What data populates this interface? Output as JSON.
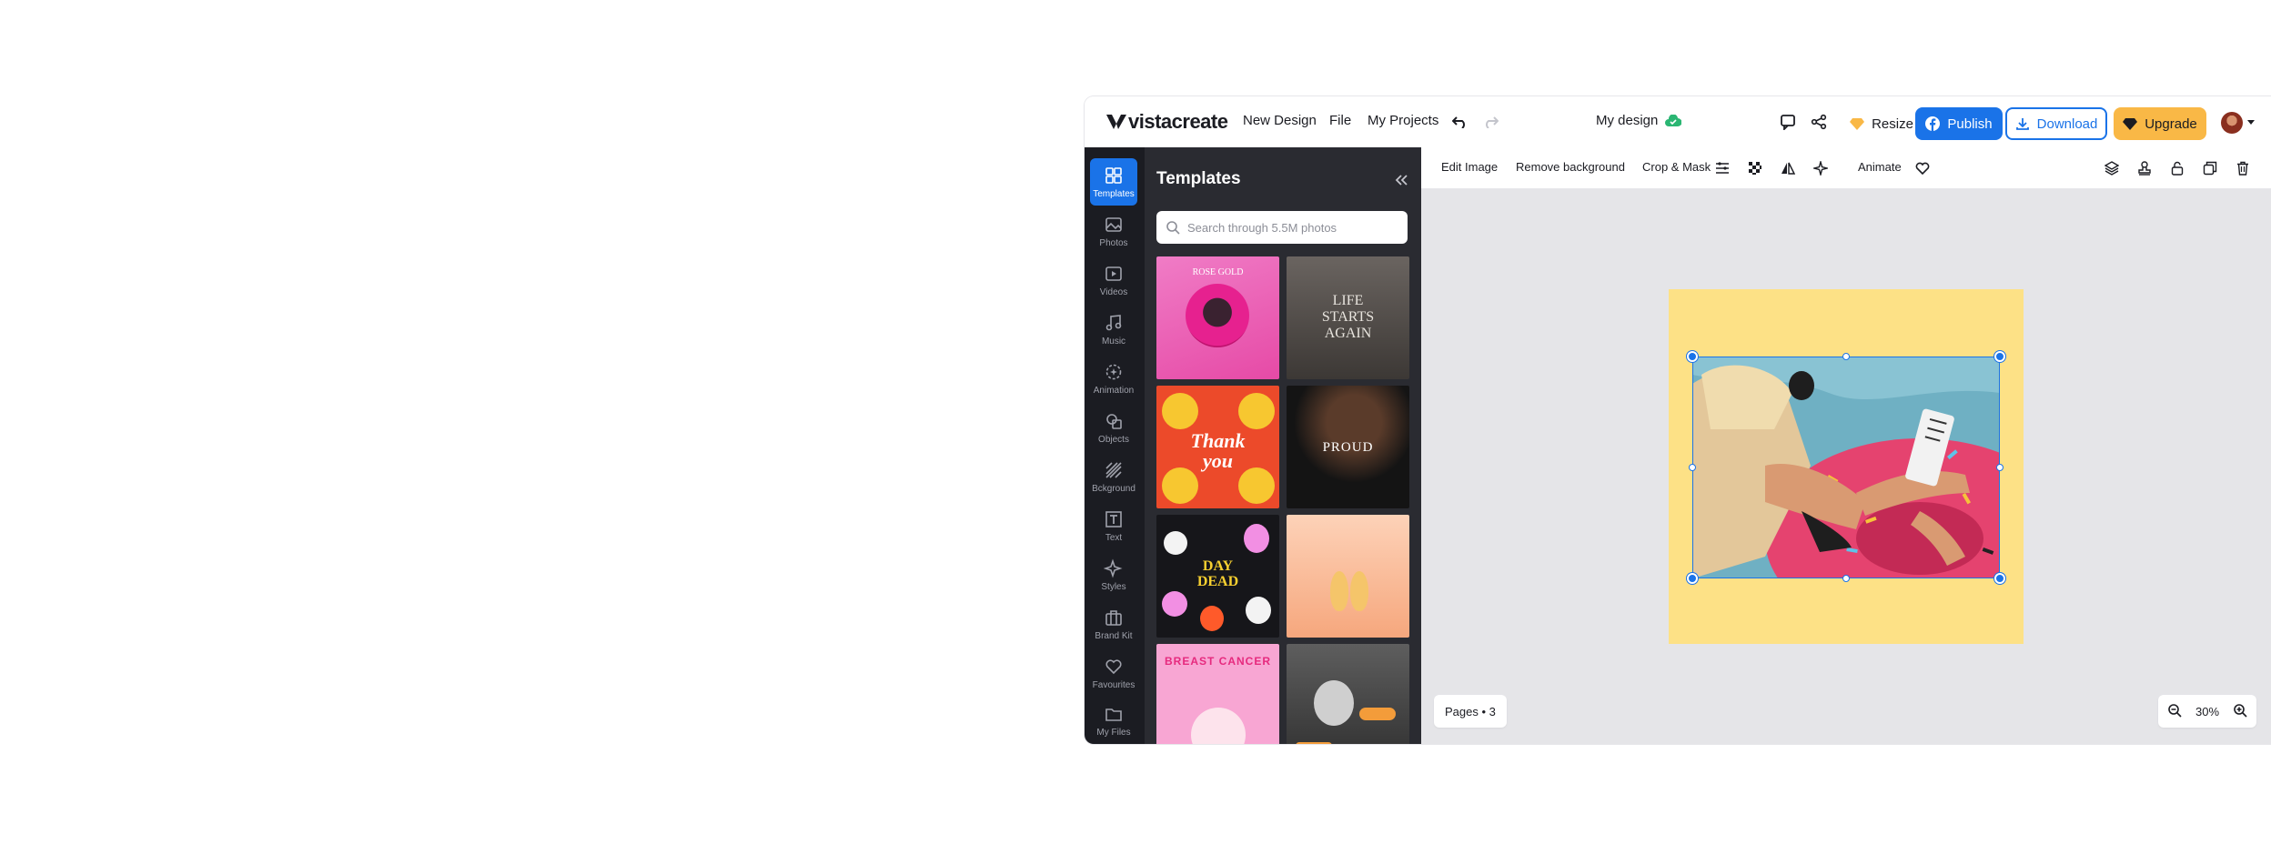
{
  "brand": {
    "logo_text": "vistacreate"
  },
  "menu": {
    "new_design": "New Design",
    "file": "File",
    "my_projects": "My Projects"
  },
  "document": {
    "title": "My design"
  },
  "actions": {
    "resize": "Resize",
    "publish": "Publish",
    "download": "Download",
    "upgrade": "Upgrade"
  },
  "colors": {
    "accent": "#1a73e8",
    "rail_bg": "#1b1c22",
    "panel_bg": "#2a2b31",
    "upgrade": "#f9b846",
    "artboard": "#fde186",
    "canvas": "#e5e5e8"
  },
  "sidebar": {
    "items": [
      {
        "label": "Templates",
        "icon": "grid-icon"
      },
      {
        "label": "Photos",
        "icon": "image-icon"
      },
      {
        "label": "Videos",
        "icon": "play-icon"
      },
      {
        "label": "Music",
        "icon": "music-note-icon"
      },
      {
        "label": "Animation",
        "icon": "animation-icon"
      },
      {
        "label": "Objects",
        "icon": "shapes-icon"
      },
      {
        "label": "Bckground",
        "icon": "background-icon"
      },
      {
        "label": "Text",
        "icon": "text-icon"
      },
      {
        "label": "Styles",
        "icon": "sparkle-icon"
      },
      {
        "label": "Brand Kit",
        "icon": "briefcase-icon"
      },
      {
        "label": "Favourites",
        "icon": "heart-icon"
      },
      {
        "label": "My Files",
        "icon": "folder-icon"
      }
    ]
  },
  "panel": {
    "title": "Templates",
    "search_placeholder": "Search through 5.5M photos",
    "thumbnails": [
      {
        "name": "pink-portrait",
        "text": "ROSE GOLD"
      },
      {
        "name": "life-starts-again",
        "text": "LIFE STARTS AGAIN"
      },
      {
        "name": "thank-you",
        "text": "Thank you"
      },
      {
        "name": "proud",
        "text": "PROUD"
      },
      {
        "name": "day-of-the-dead",
        "text": "DAY DEAD"
      },
      {
        "name": "pears",
        "text": ""
      },
      {
        "name": "breast-cancer",
        "text": "BREAST CANCER"
      },
      {
        "name": "vintage-couple",
        "text": ""
      }
    ]
  },
  "toolbar": {
    "edit_image": "Edit Image",
    "remove_background": "Remove background",
    "crop_mask": "Crop & Mask",
    "animate": "Animate"
  },
  "footer": {
    "pages": "Pages • 3",
    "zoom": "30%"
  }
}
